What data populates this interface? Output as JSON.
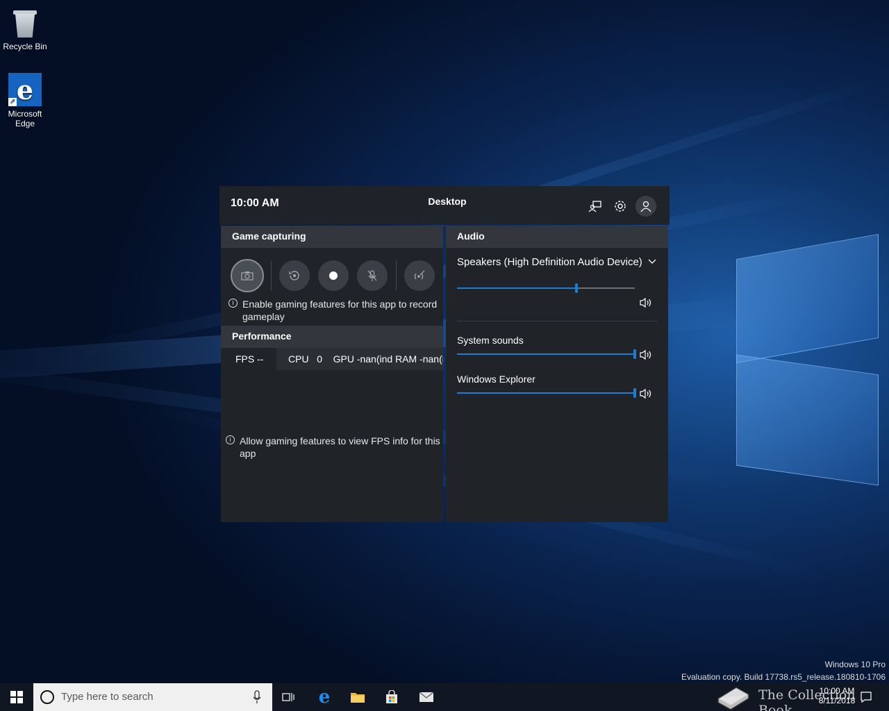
{
  "desktop": {
    "icons": [
      {
        "label": "Recycle Bin"
      },
      {
        "label": "Microsoft Edge"
      }
    ],
    "watermark": {
      "edition": "Windows 10 Pro",
      "build": "Evaluation copy. Build 17738.rs5_release.180810-1706"
    },
    "overlay_logo_text": "The Collection Book"
  },
  "gamebar": {
    "time": "10:00 AM",
    "title": "Desktop",
    "header_icons": [
      "looking-for-group-icon",
      "gear-icon",
      "account-icon"
    ],
    "capture": {
      "heading": "Game capturing",
      "buttons": [
        "camera-icon",
        "record-last-icon",
        "record-icon",
        "mic-off-icon",
        "broadcast-icon"
      ],
      "note": "Enable gaming features for this app to record gameplay"
    },
    "performance": {
      "heading": "Performance",
      "fps": "FPS --",
      "cpu_label": "CPU",
      "cpu_value": "0",
      "gpu": "GPU -nan(ind RAM -nan(ind",
      "note": "Allow gaming features to view FPS info for this app"
    },
    "audio": {
      "heading": "Audio",
      "device": "Speakers (High Definition Audio Device)",
      "master_level": 0.67,
      "apps": [
        {
          "label": "System sounds",
          "level": 1.0
        },
        {
          "label": "Windows Explorer",
          "level": 1.0
        }
      ]
    }
  },
  "taskbar": {
    "search_placeholder": "Type here to search",
    "pinned": [
      "task-view-icon",
      "edge-icon",
      "file-explorer-icon",
      "store-icon",
      "mail-icon"
    ],
    "clock_time": "10:00 AM",
    "clock_date": "8/11/2018"
  }
}
